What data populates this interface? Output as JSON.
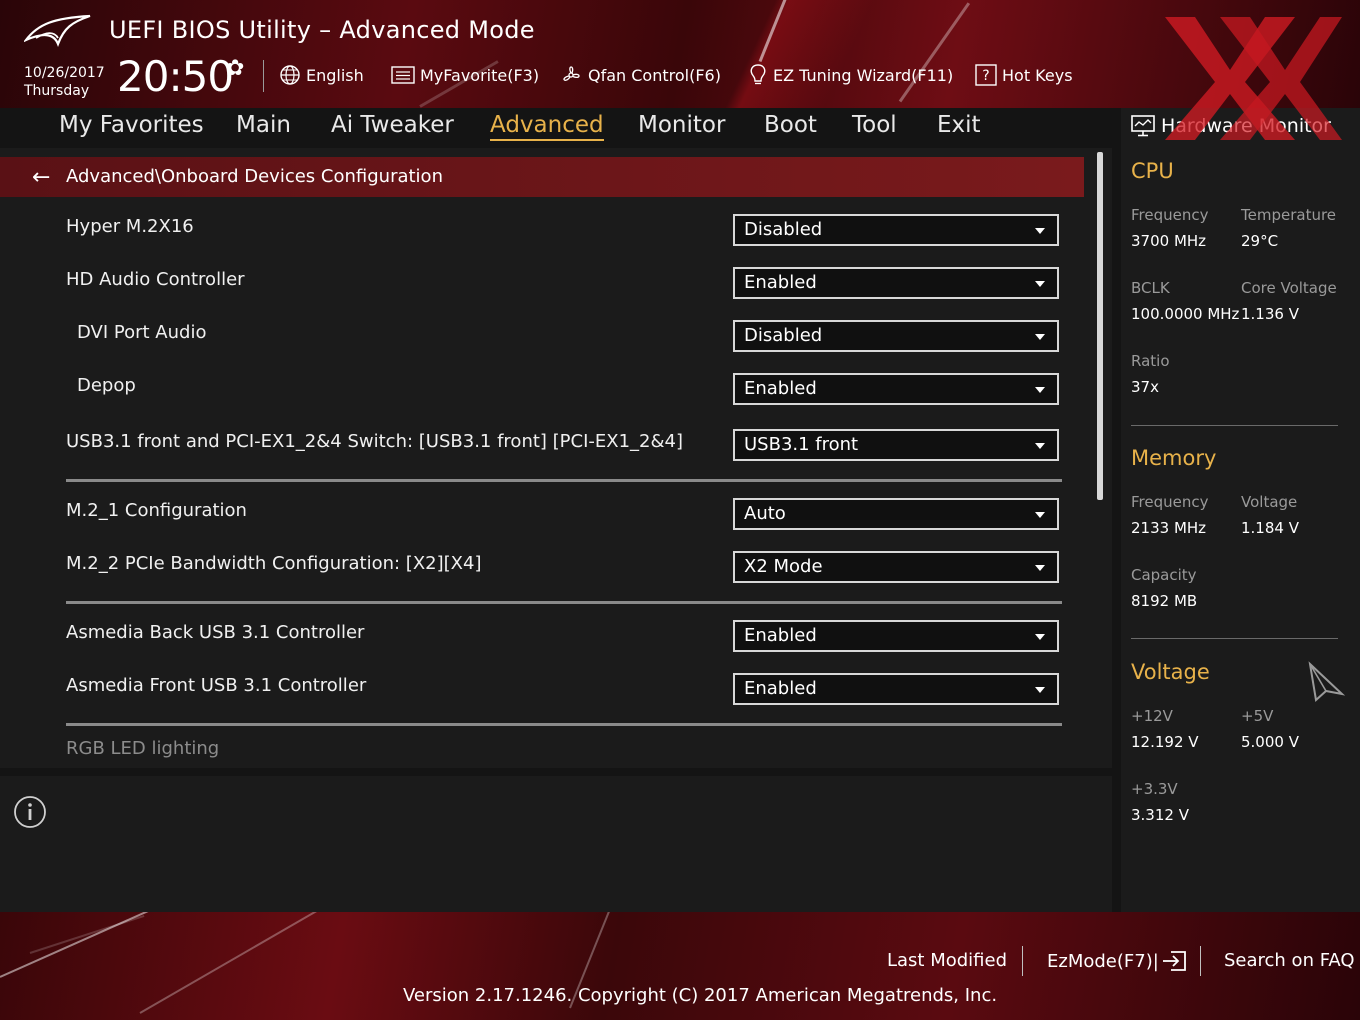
{
  "header": {
    "title": "UEFI BIOS Utility – Advanced Mode",
    "date": "10/26/2017",
    "weekday": "Thursday",
    "time": "20:50"
  },
  "toolbar": {
    "language": "English",
    "my_favorite": "MyFavorite(F3)",
    "qfan": "Qfan Control(F6)",
    "ez_tuning": "EZ Tuning Wizard(F11)",
    "hot_keys": "Hot Keys"
  },
  "tabs": [
    "My Favorites",
    "Main",
    "Ai Tweaker",
    "Advanced",
    "Monitor",
    "Boot",
    "Tool",
    "Exit"
  ],
  "active_tab": "Advanced",
  "breadcrumb": "Advanced\\Onboard Devices Configuration",
  "settings": [
    {
      "label": "Hyper M.2X16",
      "value": "Disabled"
    },
    {
      "label": "HD Audio Controller",
      "value": "Enabled"
    },
    {
      "label": "DVI Port Audio",
      "value": "Disabled"
    },
    {
      "label": "Depop",
      "value": "Enabled"
    },
    {
      "label": "USB3.1 front and PCI-EX1_2&4 Switch: [USB3.1 front] [PCI-EX1_2&4]",
      "value": "USB3.1 front"
    },
    {
      "label": "M.2_1 Configuration",
      "value": "Auto"
    },
    {
      "label": "M.2_2 PCIe Bandwidth Configuration: [X2][X4]",
      "value": "X2 Mode"
    },
    {
      "label": "Asmedia Back USB 3.1 Controller",
      "value": "Enabled"
    },
    {
      "label": "Asmedia Front USB 3.1 Controller",
      "value": "Enabled"
    }
  ],
  "rgb_label": "RGB LED lighting",
  "hw_monitor": {
    "title": "Hardware Monitor",
    "cpu": {
      "heading": "CPU",
      "frequency_label": "Frequency",
      "frequency": "3700 MHz",
      "temperature_label": "Temperature",
      "temperature": "29°C",
      "bclk_label": "BCLK",
      "bclk": "100.0000 MHz",
      "core_voltage_label": "Core Voltage",
      "core_voltage": "1.136 V",
      "ratio_label": "Ratio",
      "ratio": "37x"
    },
    "memory": {
      "heading": "Memory",
      "frequency_label": "Frequency",
      "frequency": "2133 MHz",
      "voltage_label": "Voltage",
      "voltage": "1.184 V",
      "capacity_label": "Capacity",
      "capacity": "8192 MB"
    },
    "voltage": {
      "heading": "Voltage",
      "v12_label": "+12V",
      "v12": "12.192 V",
      "v5_label": "+5V",
      "v5": "5.000 V",
      "v33_label": "+3.3V",
      "v33": "3.312 V"
    }
  },
  "footer": {
    "last_modified": "Last Modified",
    "ezmode": "EzMode(F7)|",
    "search_faq": "Search on FAQ",
    "version": "Version 2.17.1246. Copyright (C) 2017 American Megatrends, Inc."
  },
  "colors": {
    "accent": "#e8b24a",
    "breadcrumb_bg": "#7a1a1c",
    "panel_bg": "#1b1b1b",
    "watermark": "#d41b23"
  }
}
